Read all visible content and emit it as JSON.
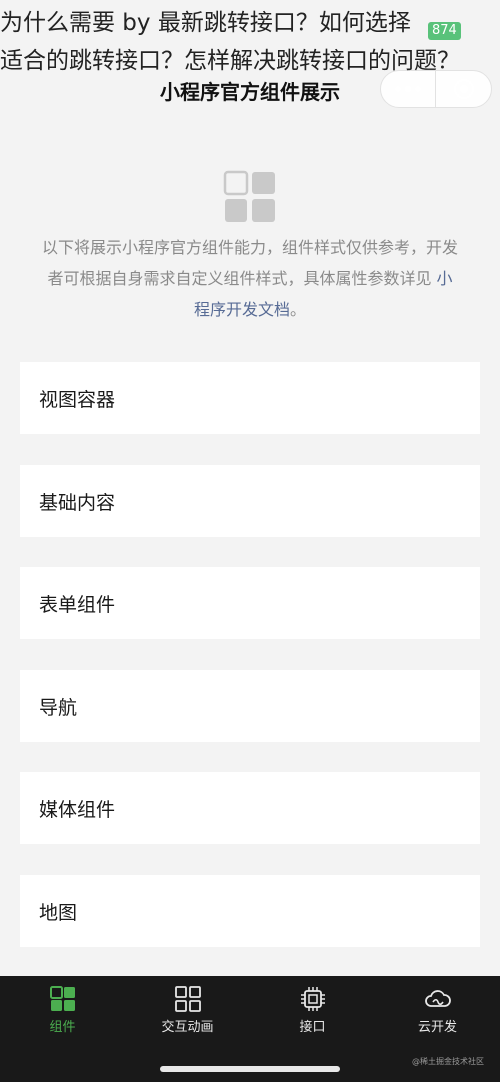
{
  "overlay": {
    "line1": "为什么需要 by 最新跳转接口？如何选择",
    "line2": "适合的跳转接口？怎样解决跳转接口的问题？",
    "badge": "874"
  },
  "nav": {
    "title": "小程序官方组件展示"
  },
  "intro": {
    "text": "以下将展示小程序官方组件能力，组件样式仅供参考，开发者可根据自身需求自定义组件样式，具体属性参数详见 ",
    "link": "小程序开发文档",
    "tail": "。"
  },
  "menu": {
    "items": [
      "视图容器",
      "基础内容",
      "表单组件",
      "导航",
      "媒体组件",
      "地图"
    ]
  },
  "tabbar": {
    "tabs": [
      {
        "label": "组件",
        "icon": "components-icon",
        "active": true
      },
      {
        "label": "交互动画",
        "icon": "interaction-icon",
        "active": false
      },
      {
        "label": "接口",
        "icon": "chip-icon",
        "active": false
      },
      {
        "label": "云开发",
        "icon": "cloud-icon",
        "active": false
      }
    ]
  },
  "watermark": "@稀土掘金技术社区",
  "colors": {
    "background": "#f3f3f3",
    "tabbar": "#191919",
    "active_tab": "#4caf50",
    "link": "#576b95",
    "intro_text": "#8a8a8a"
  }
}
